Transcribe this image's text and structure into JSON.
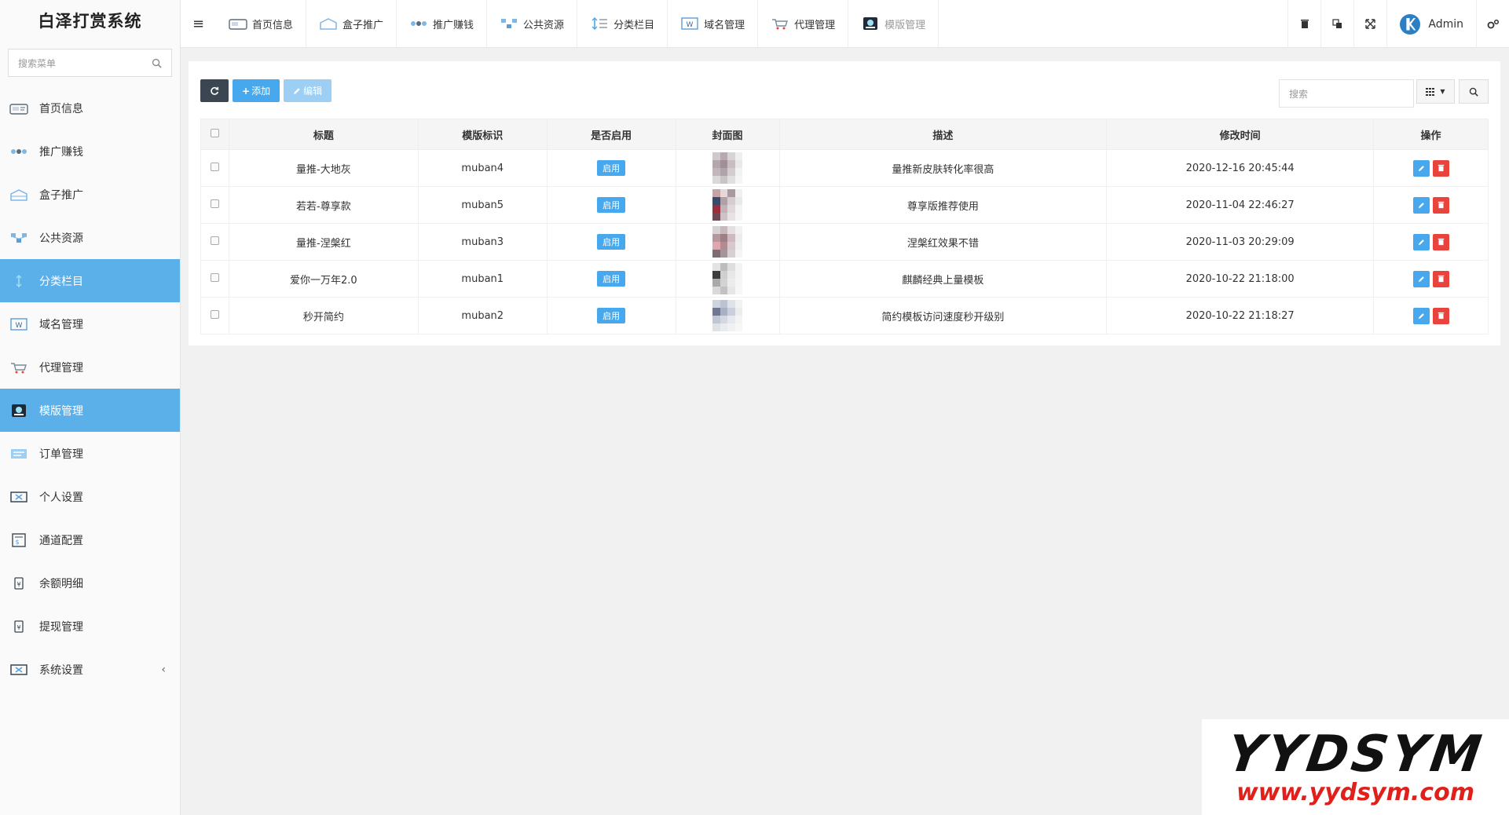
{
  "sidebar": {
    "brand": "白泽打赏系统",
    "search_placeholder": "搜索菜单",
    "items": [
      {
        "label": "首页信息",
        "icon": "home-info-icon"
      },
      {
        "label": "推广赚钱",
        "icon": "promote-earn-icon"
      },
      {
        "label": "盒子推广",
        "icon": "box-promote-icon"
      },
      {
        "label": "公共资源",
        "icon": "public-resource-icon"
      },
      {
        "label": "分类栏目",
        "icon": "category-icon",
        "active": true
      },
      {
        "label": "域名管理",
        "icon": "domain-icon"
      },
      {
        "label": "代理管理",
        "icon": "agent-icon"
      },
      {
        "label": "模版管理",
        "icon": "template-icon",
        "active": true
      },
      {
        "label": "订单管理",
        "icon": "order-icon"
      },
      {
        "label": "个人设置",
        "icon": "personal-settings-icon"
      },
      {
        "label": "通道配置",
        "icon": "channel-config-icon"
      },
      {
        "label": "余额明细",
        "icon": "balance-icon"
      },
      {
        "label": "提现管理",
        "icon": "withdraw-icon"
      },
      {
        "label": "系统设置",
        "icon": "system-settings-icon",
        "has_children": true
      }
    ]
  },
  "topbar": {
    "tabs": [
      {
        "label": "首页信息"
      },
      {
        "label": "盒子推广"
      },
      {
        "label": "推广赚钱"
      },
      {
        "label": "公共资源"
      },
      {
        "label": "分类栏目"
      },
      {
        "label": "域名管理"
      },
      {
        "label": "代理管理"
      },
      {
        "label": "模版管理",
        "dim": true
      }
    ],
    "user": "Admin"
  },
  "toolbar": {
    "add_label": "添加",
    "edit_label": "编辑",
    "search_placeholder": "搜索"
  },
  "table": {
    "headers": [
      "标题",
      "模版标识",
      "是否启用",
      "封面图",
      "描述",
      "修改时间",
      "操作"
    ],
    "rows": [
      {
        "title": "量推-大地灰",
        "key": "muban4",
        "status": "启用",
        "desc": "量推新皮肤转化率很高",
        "time": "2020-12-16 20:45:44"
      },
      {
        "title": "若若-尊享款",
        "key": "muban5",
        "status": "启用",
        "desc": "尊享版推荐使用",
        "time": "2020-11-04 22:46:27"
      },
      {
        "title": "量推-涅槃红",
        "key": "muban3",
        "status": "启用",
        "desc": "涅槃红效果不错",
        "time": "2020-11-03 20:29:09"
      },
      {
        "title": "爱你一万年2.0",
        "key": "muban1",
        "status": "启用",
        "desc": "麒麟经典上量模板",
        "time": "2020-10-22 21:18:00"
      },
      {
        "title": "秒开简约",
        "key": "muban2",
        "status": "启用",
        "desc": "简约模板访问速度秒开级别",
        "time": "2020-10-22 21:18:27"
      }
    ]
  },
  "watermark": {
    "big": "YYDSYM",
    "small": "www.yydsym.com"
  },
  "colors": {
    "accent": "#5cb0ea",
    "button_blue": "#48a8ee",
    "danger": "#e8433c",
    "dark": "#3b4652"
  }
}
